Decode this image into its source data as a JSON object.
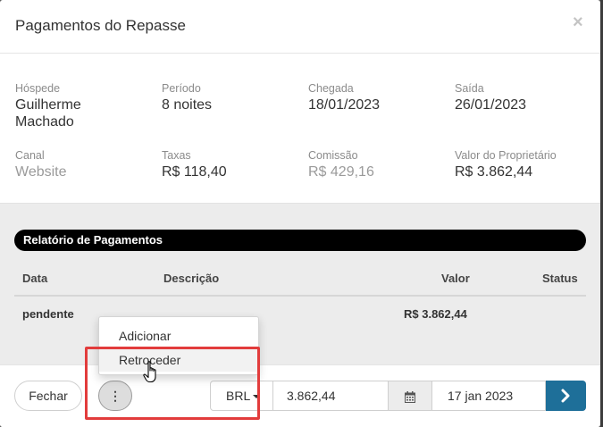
{
  "modal": {
    "title": "Pagamentos do Repasse",
    "close_label": "×"
  },
  "details": {
    "hospede": {
      "label": "Hóspede",
      "value_line1": "Guilherme",
      "value_line2": "Machado"
    },
    "periodo": {
      "label": "Período",
      "value": "8 noites"
    },
    "chegada": {
      "label": "Chegada",
      "value": "18/01/2023"
    },
    "saida": {
      "label": "Saída",
      "value": "26/01/2023"
    },
    "canal": {
      "label": "Canal",
      "value": "Website"
    },
    "taxas": {
      "label": "Taxas",
      "value": "R$ 118,40"
    },
    "comissao": {
      "label": "Comissão",
      "value": "R$ 429,16"
    },
    "valor_proprietario": {
      "label": "Valor do Proprietário",
      "value": "R$ 3.862,44"
    }
  },
  "report": {
    "title": "Relatório de Pagamentos",
    "columns": [
      "Data",
      "Descrição",
      "Valor",
      "Status"
    ],
    "rows": [
      {
        "data": "pendente",
        "descricao": "",
        "valor": "R$ 3.862,44",
        "status": ""
      }
    ]
  },
  "menu": {
    "items": [
      "Adicionar",
      "Retroceder"
    ],
    "hovered": "Retroceder"
  },
  "footer": {
    "close_button": "Fechar",
    "more_button": "⋮",
    "currency": "BRL",
    "amount": "3.862,44",
    "date": "17 jan 2023"
  },
  "colors": {
    "primary": "#1e6f99",
    "highlight": "#e23c3c",
    "report_bar": "#000000"
  },
  "icons": {
    "calendar": "calendar-icon",
    "submit": "chevron-right-icon",
    "menu": "vertical-dots-icon"
  }
}
